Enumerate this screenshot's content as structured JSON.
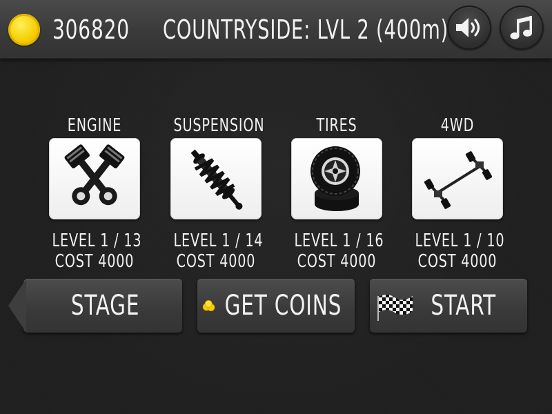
{
  "header": {
    "coins": "306820",
    "level_title": "COUNTRYSIDE: LVL 2 (400m)"
  },
  "upgrades": [
    {
      "name": "ENGINE",
      "level": "LEVEL 1 / 13",
      "cost": "COST 4000",
      "icon": "engine-pistons-icon"
    },
    {
      "name": "SUSPENSION",
      "level": "LEVEL 1 / 14",
      "cost": "COST 4000",
      "icon": "suspension-spring-icon"
    },
    {
      "name": "TIRES",
      "level": "LEVEL 1 / 16",
      "cost": "COST 4000",
      "icon": "tires-icon"
    },
    {
      "name": "4WD",
      "level": "LEVEL 1 / 10",
      "cost": "COST 4000",
      "icon": "4wd-axle-icon"
    }
  ],
  "buttons": {
    "stage": "STAGE",
    "get_coins": "GET COINS",
    "start": "START"
  },
  "colors": {
    "coin": "#f5cf00",
    "background": "#1f1f1f",
    "bar": "#3a3a3a"
  }
}
